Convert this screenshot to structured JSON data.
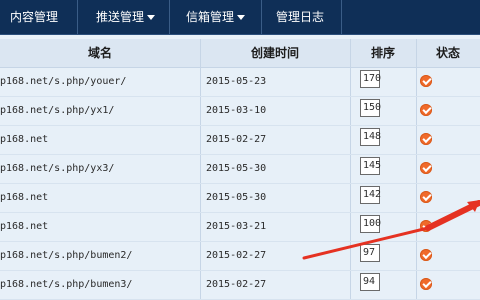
{
  "nav": [
    {
      "label": "内容管理",
      "has_caret": true
    },
    {
      "label": "推送管理",
      "has_caret": true
    },
    {
      "label": "信箱管理",
      "has_caret": true
    },
    {
      "label": "管理日志",
      "has_caret": false
    }
  ],
  "table": {
    "columns": [
      "域名",
      "创建时间",
      "排序",
      "状态"
    ],
    "rows": [
      {
        "domain": "p168.net/s.php/youer/",
        "created": "2015-05-23",
        "sort": "170"
      },
      {
        "domain": "p168.net/s.php/yx1/",
        "created": "2015-03-10",
        "sort": "150"
      },
      {
        "domain": "p168.net",
        "created": "2015-02-27",
        "sort": "148"
      },
      {
        "domain": "p168.net/s.php/yx3/",
        "created": "2015-05-30",
        "sort": "145"
      },
      {
        "domain": "p168.net",
        "created": "2015-05-30",
        "sort": "142"
      },
      {
        "domain": "p168.net",
        "created": "2015-03-21",
        "sort": "100"
      },
      {
        "domain": "p168.net/s.php/bumen2/",
        "created": "2015-02-27",
        "sort": "97"
      },
      {
        "domain": "p168.net/s.php/bumen3/",
        "created": "2015-02-27",
        "sort": "94"
      }
    ]
  },
  "colors": {
    "nav_bg": "#0f2f57",
    "status_icon": "#f06a2a",
    "annotation_arrow": "#e53222"
  }
}
